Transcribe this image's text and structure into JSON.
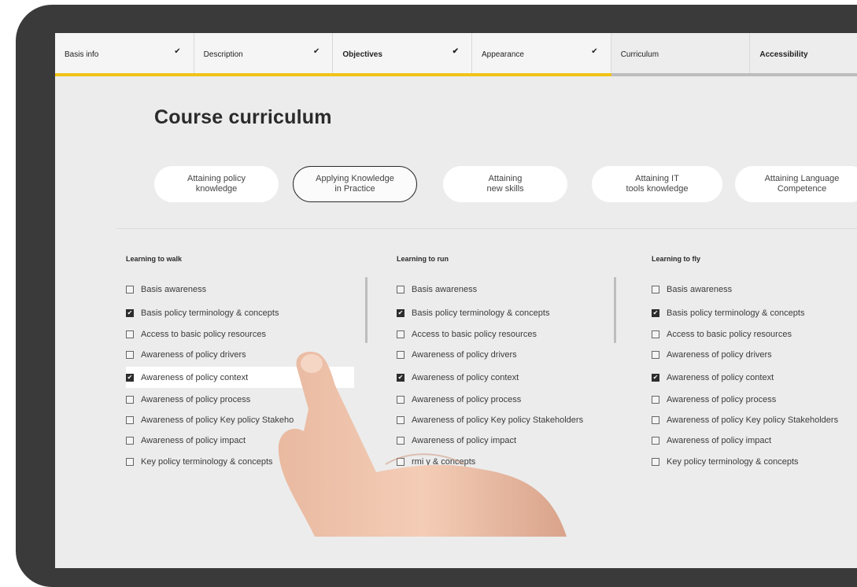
{
  "tabs": [
    {
      "label": "Basis info",
      "check": "✔",
      "bold": false,
      "state": "done"
    },
    {
      "label": "Description",
      "check": "✔",
      "bold": false,
      "state": "done"
    },
    {
      "label": "Objectives",
      "check": "✔",
      "bold": true,
      "state": "done"
    },
    {
      "label": "Appearance",
      "check": "✔",
      "bold": false,
      "state": "done"
    },
    {
      "label": "Curriculum",
      "check": "",
      "bold": false,
      "state": "pending"
    },
    {
      "label": "Accessibility",
      "check": "",
      "bold": true,
      "state": "pending"
    }
  ],
  "page_title": "Course curriculum",
  "pills": [
    {
      "label": "Attaining policy\nknowledge",
      "active": false
    },
    {
      "label": "Applying Knowledge\nin Practice",
      "active": true
    },
    {
      "label": "Attaining\nnew skills",
      "active": false
    },
    {
      "label": "Attaining IT\ntools knowledge",
      "active": false
    },
    {
      "label": "Attaining Language\nCompetence",
      "active": false
    }
  ],
  "columns": [
    {
      "title": "Learning to walk",
      "items": [
        {
          "label": "Basis awareness",
          "checked": false
        },
        {
          "label": "Basis policy terminology & concepts",
          "checked": true
        },
        {
          "label": "Access to basic policy resources",
          "checked": false
        },
        {
          "label": "Awareness of policy drivers",
          "checked": false
        },
        {
          "label": "Awareness of policy context",
          "checked": true
        },
        {
          "label": "Awareness of policy process",
          "checked": false
        },
        {
          "label": "Awareness of policy Key policy Stakeho",
          "checked": false
        },
        {
          "label": "Awareness of policy impact",
          "checked": false
        },
        {
          "label": "Key policy terminology & concepts",
          "checked": false
        }
      ]
    },
    {
      "title": "Learning to run",
      "items": [
        {
          "label": "Basis awareness",
          "checked": false
        },
        {
          "label": "Basis policy terminology & concepts",
          "checked": true
        },
        {
          "label": "Access to basic policy resources",
          "checked": false
        },
        {
          "label": "Awareness of policy drivers",
          "checked": false
        },
        {
          "label": "Awareness of policy context",
          "checked": true
        },
        {
          "label": "Awareness of policy process",
          "checked": false
        },
        {
          "label": "Awareness of policy Key policy Stakeholders",
          "checked": false
        },
        {
          "label": "Awareness of policy impact",
          "checked": false
        },
        {
          "label": "rmi   y & concepts",
          "checked": false
        }
      ]
    },
    {
      "title": "Learning to fly",
      "items": [
        {
          "label": "Basis awareness",
          "checked": false
        },
        {
          "label": "Basis policy terminology & concepts",
          "checked": true
        },
        {
          "label": "Access to basic policy resources",
          "checked": false
        },
        {
          "label": "Awareness of policy drivers",
          "checked": false
        },
        {
          "label": "Awareness of policy context",
          "checked": true
        },
        {
          "label": "Awareness of policy process",
          "checked": false
        },
        {
          "label": "Awareness of policy Key policy Stakeholders",
          "checked": false
        },
        {
          "label": "Awareness of policy impact",
          "checked": false
        },
        {
          "label": "Key policy terminology & concepts",
          "checked": false
        }
      ]
    }
  ],
  "colors": {
    "accent": "#f2c318",
    "pending_bar": "#bdbdbd",
    "device": "#3a3a3a",
    "screen": "#ececec"
  }
}
